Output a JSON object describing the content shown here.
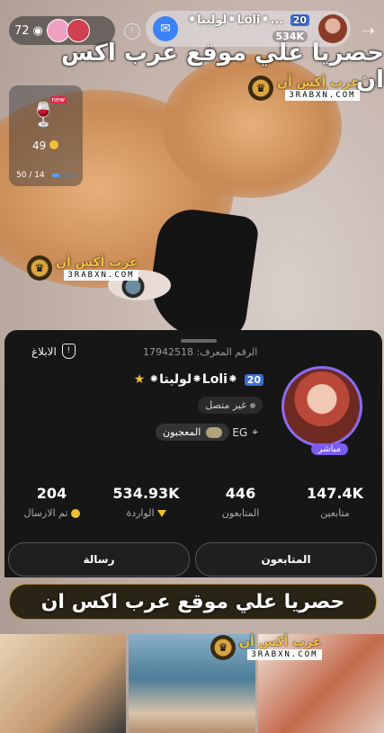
{
  "watermark": {
    "top_banner": "حصريا علي موقع عرب اكس ان",
    "logo_arabic": "عرب أكس أن",
    "logo_url": "3RABXN.COM",
    "middle_logo_arabic": "عرب أكس أن",
    "middle_logo_url": "3RABXN.COM",
    "bottom_logo_arabic": "عرب أكس أن",
    "bottom_logo_url": "3RABXN.COM",
    "bottom_banner": "حصريا علي موقع عرب اكس ان"
  },
  "topbar": {
    "viewer_count": "72",
    "host_name": "⁕لوليتا⁕Loli⁕...",
    "host_level": "20",
    "host_count": "534K"
  },
  "gift": {
    "new_badge": "new",
    "value": "49",
    "progress": "50 / 14",
    "bar_fraction": 0.3
  },
  "profile": {
    "report_label": "الابلاغ",
    "id_label": "الرقم المعرف: 17942518",
    "name": "⁕لوليتا⁕Loli⁕",
    "level": "20",
    "status": "غير متصل",
    "country": "EG",
    "fans_badge": "المعجبون",
    "live_tag": "مباشر",
    "stats": [
      {
        "value": "204",
        "label": "تم الارسال"
      },
      {
        "value": "534.93K",
        "label": "الواردة"
      },
      {
        "value": "446",
        "label": "المتابعون"
      },
      {
        "value": "147.4K",
        "label": "متابعين"
      }
    ],
    "message_button": "رسالة",
    "follow_button": "المتابعون"
  },
  "exclusive_bar": {
    "label": "حصريا علي موقع عرب اكس ان"
  },
  "colors": {
    "accent_purple": "#7c5cf0",
    "level_blue": "#3b6fd8",
    "gold": "#f0c030"
  }
}
